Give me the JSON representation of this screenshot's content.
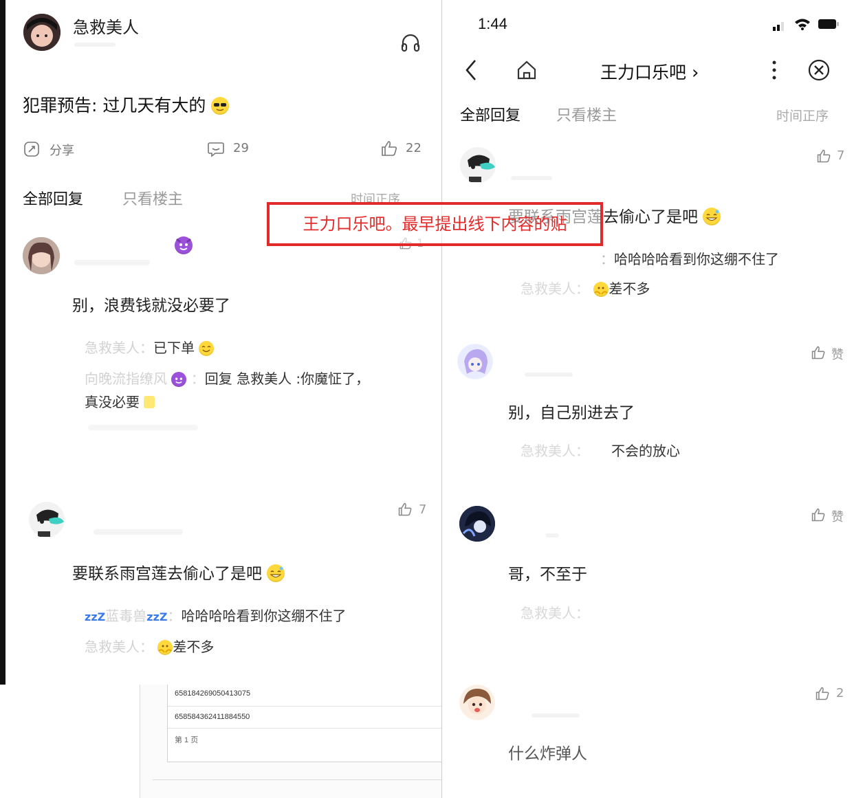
{
  "left": {
    "author_name": "急救美人",
    "post_title": "犯罪预告: 过几天有大的",
    "actions": {
      "share": "分享",
      "comments": "29",
      "likes": "22"
    },
    "tabs": {
      "all": "全部回复",
      "owner_only": "只看楼主",
      "sort": "时间正序"
    },
    "comment1": {
      "text": "别，浪费钱就没必要了",
      "like_count": "1",
      "replies": [
        {
          "user": "急救美人：",
          "text": "已下单"
        },
        {
          "user": "向晚流指缭风",
          "text": "回复 急救美人 :你魔怔了，",
          "text2": "真没必要"
        }
      ]
    },
    "comment2": {
      "text": "要联系雨宫莲去偷心了是吧",
      "like_count": "7",
      "replies": [
        {
          "prefix": "zzZ",
          "user": "蓝毒兽",
          "suffix": "zzZ",
          "sep": "：",
          "text": "哈哈哈哈看到你这绷不住了"
        },
        {
          "user": "急救美人：",
          "text": "差不多"
        }
      ]
    }
  },
  "doc": {
    "rows": [
      "658184269050413075",
      "658584362411884550"
    ],
    "footer": "第 1 页"
  },
  "right": {
    "status": {
      "time": "1:44"
    },
    "nav": {
      "title": "王力口乐吧",
      "chevron": "›"
    },
    "tabs": {
      "all": "全部回复",
      "owner_only": "只看楼主",
      "sort": "时间正序"
    },
    "comments": [
      {
        "like_count": "7",
        "text": "要联系雨宫莲去偷心了是吧",
        "replies": [
          {
            "user": "：",
            "text": "哈哈哈哈看到你这绷不住了"
          },
          {
            "user": "急救美人：",
            "text": "差不多"
          }
        ]
      },
      {
        "like_count": "赞",
        "text": "别，自己别进去了",
        "replies": [
          {
            "user": "急救美人：",
            "text": "不会的放心"
          }
        ]
      },
      {
        "like_count": "赞",
        "text": "哥，不至于",
        "replies": [
          {
            "user": "急救美人：",
            "text": ""
          }
        ]
      },
      {
        "like_count": "2",
        "text": "什么炸弹人",
        "replies": []
      }
    ]
  },
  "annotation": {
    "text": "王力口乐吧。最早提出线下内容的贴"
  },
  "colors": {
    "annotation": "#e22a2a",
    "muted_text": "#9a9a9a",
    "emoji_yellow": "#ffd83b"
  }
}
